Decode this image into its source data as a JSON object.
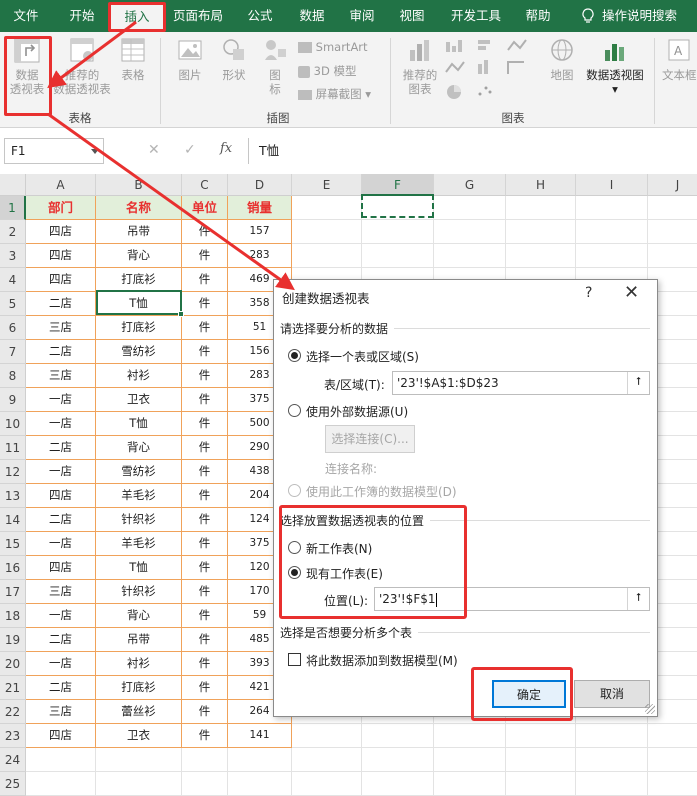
{
  "ribbon_tabs": [
    "文件",
    "开始",
    "插入",
    "页面布局",
    "公式",
    "数据",
    "审阅",
    "视图",
    "开发工具",
    "帮助",
    "操作说明搜索"
  ],
  "ribbon": {
    "pivot_label_1": "数据",
    "pivot_label_2": "透视表",
    "rec_pivot_1": "推荐的",
    "rec_pivot_2": "数据透视表",
    "table": "表格",
    "group_tables": "表格",
    "picture": "图片",
    "shapes": "形状",
    "icons_1": "图",
    "icons_2": "标",
    "smartart": "SmartArt",
    "model3d": "3D 模型",
    "screenshot": "屏幕截图",
    "group_illustrations": "插图",
    "rec_charts_1": "推荐的",
    "rec_charts_2": "图表",
    "maps": "地图",
    "pivot_chart": "数据透视图",
    "group_charts": "图表",
    "text": "文本框"
  },
  "formula_bar": {
    "name_box": "F1",
    "cancel_icon": "✕",
    "enter_icon": "✓",
    "fx": "fx",
    "content": "T恤"
  },
  "sheet": {
    "columns": [
      "A",
      "B",
      "C",
      "D",
      "E",
      "F",
      "G",
      "H",
      "I",
      "J"
    ],
    "headers": [
      "部门",
      "名称",
      "单位",
      "销量"
    ],
    "rows": [
      [
        "四店",
        "吊带",
        "件",
        "157"
      ],
      [
        "四店",
        "背心",
        "件",
        "283"
      ],
      [
        "四店",
        "打底衫",
        "件",
        "469"
      ],
      [
        "二店",
        "T恤",
        "件",
        "358"
      ],
      [
        "三店",
        "打底衫",
        "件",
        "51"
      ],
      [
        "二店",
        "雪纺衫",
        "件",
        "156"
      ],
      [
        "三店",
        "衬衫",
        "件",
        "283"
      ],
      [
        "一店",
        "卫衣",
        "件",
        "375"
      ],
      [
        "一店",
        "T恤",
        "件",
        "500"
      ],
      [
        "二店",
        "背心",
        "件",
        "290"
      ],
      [
        "一店",
        "雪纺衫",
        "件",
        "438"
      ],
      [
        "四店",
        "羊毛衫",
        "件",
        "204"
      ],
      [
        "二店",
        "针织衫",
        "件",
        "124"
      ],
      [
        "一店",
        "羊毛衫",
        "件",
        "375"
      ],
      [
        "四店",
        "T恤",
        "件",
        "120"
      ],
      [
        "三店",
        "针织衫",
        "件",
        "170"
      ],
      [
        "一店",
        "背心",
        "件",
        "59"
      ],
      [
        "二店",
        "吊带",
        "件",
        "485"
      ],
      [
        "一店",
        "衬衫",
        "件",
        "393"
      ],
      [
        "二店",
        "打底衫",
        "件",
        "421"
      ],
      [
        "三店",
        "蕾丝衫",
        "件",
        "264"
      ],
      [
        "四店",
        "卫衣",
        "件",
        "141"
      ]
    ]
  },
  "dialog": {
    "title": "创建数据透视表",
    "help": "?",
    "close": "✕",
    "section_data": "请选择要分析的数据",
    "opt_table_range": "选择一个表或区域(S)",
    "table_range_label": "表/区域(T):",
    "table_range_value": "'23'!$A$1:$D$23",
    "opt_external": "使用外部数据源(U)",
    "choose_connection": "选择连接(C)...",
    "connection_name": "连接名称:",
    "opt_data_model": "使用此工作簿的数据模型(D)",
    "section_location": "选择放置数据透视表的位置",
    "opt_new_sheet": "新工作表(N)",
    "opt_existing_sheet": "现有工作表(E)",
    "location_label": "位置(L):",
    "location_value": "'23'!$F$1",
    "section_multi": "选择是否想要分析多个表",
    "add_to_model": "将此数据添加到数据模型(M)",
    "ok": "确定",
    "cancel": "取消"
  },
  "colors": {
    "excel_green": "#217346",
    "highlight_red": "#e8302f",
    "header_fill": "#e2efda",
    "table_border": "#f0a25a"
  }
}
